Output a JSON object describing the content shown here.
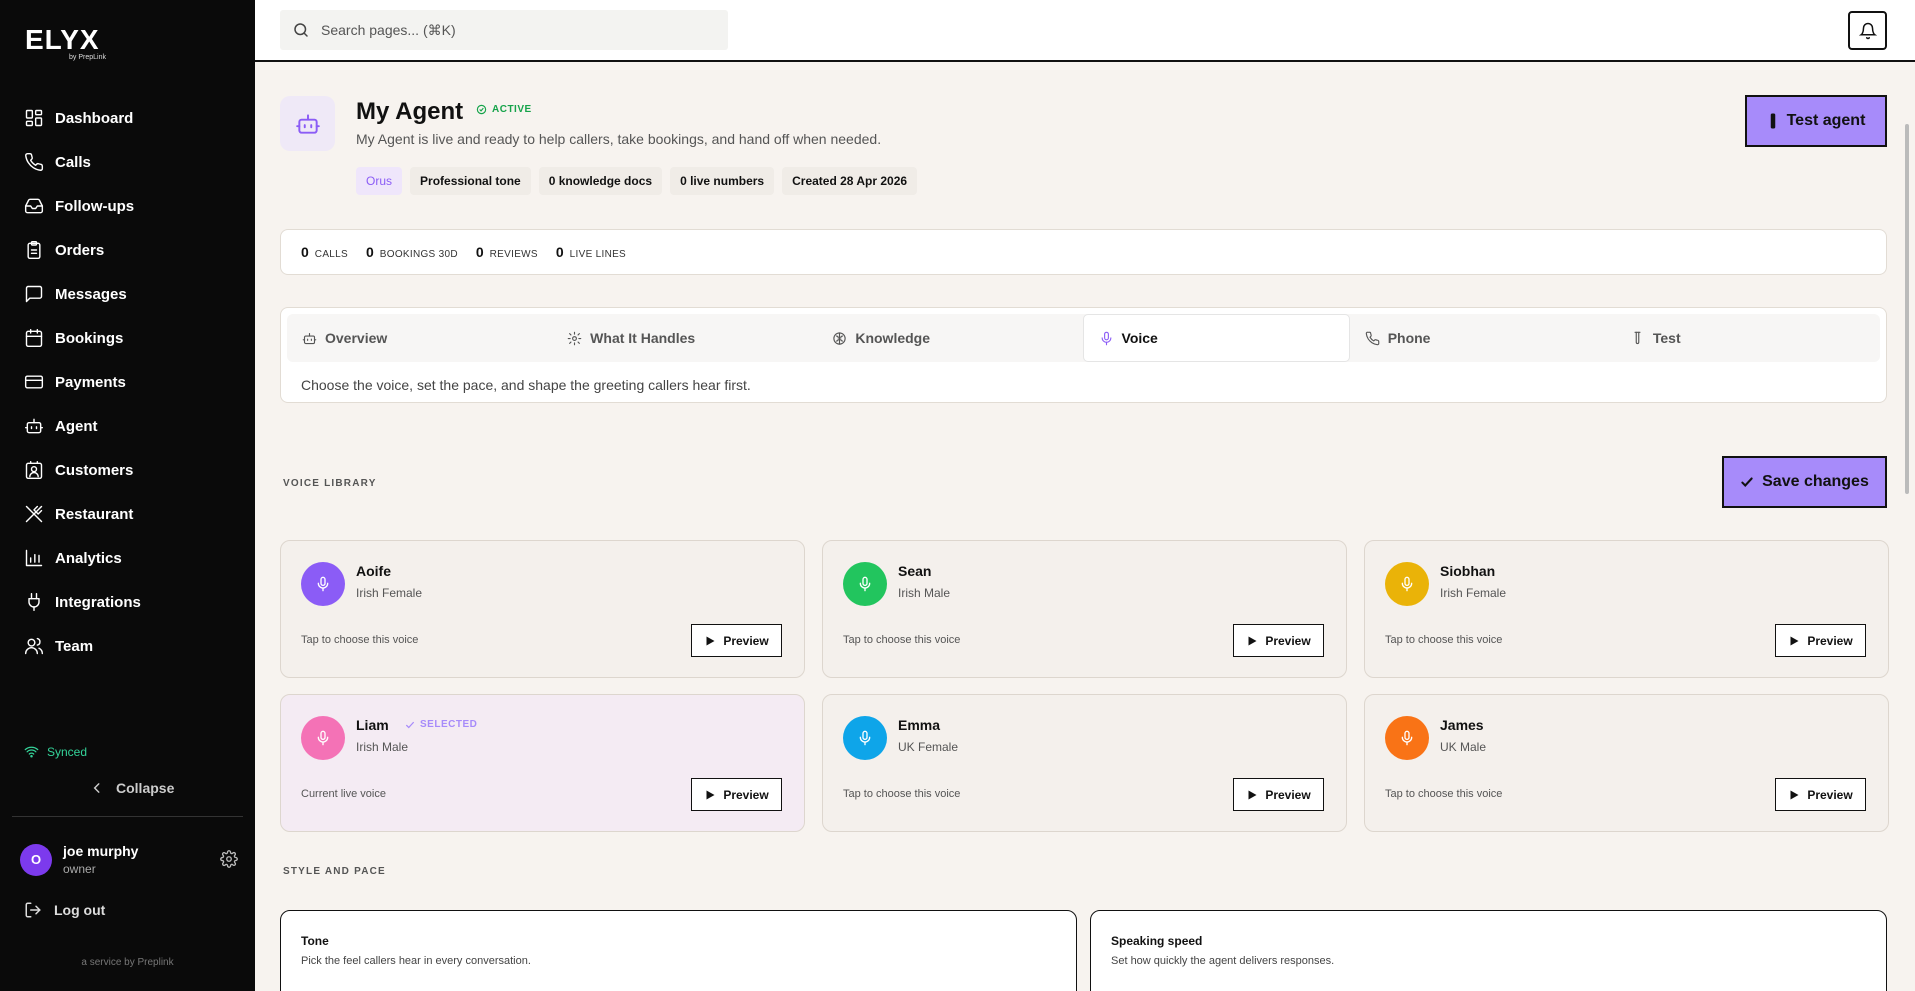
{
  "brand": {
    "logo": "ELYX",
    "logo_sub": "by PrepLink",
    "service": "a service by Preplink"
  },
  "sidebar": {
    "items": [
      {
        "label": "Dashboard",
        "icon": "dashboard-icon"
      },
      {
        "label": "Calls",
        "icon": "phone-icon"
      },
      {
        "label": "Follow-ups",
        "icon": "inbox-icon"
      },
      {
        "label": "Orders",
        "icon": "clipboard-icon"
      },
      {
        "label": "Messages",
        "icon": "message-icon"
      },
      {
        "label": "Bookings",
        "icon": "calendar-icon"
      },
      {
        "label": "Payments",
        "icon": "credit-card-icon"
      },
      {
        "label": "Agent",
        "icon": "robot-icon"
      },
      {
        "label": "Customers",
        "icon": "contact-icon"
      },
      {
        "label": "Restaurant",
        "icon": "utensils-icon"
      },
      {
        "label": "Analytics",
        "icon": "bar-chart-icon"
      },
      {
        "label": "Integrations",
        "icon": "plug-icon"
      },
      {
        "label": "Team",
        "icon": "users-icon"
      }
    ],
    "synced": "Synced",
    "collapse": "Collapse",
    "user": {
      "initial": "O",
      "name": "joe murphy",
      "role": "owner"
    },
    "logout": "Log out"
  },
  "topbar": {
    "search_placeholder": "Search pages... (⌘K)"
  },
  "agent": {
    "title": "My Agent",
    "status": "ACTIVE",
    "description": "My Agent is live and ready to help callers, take bookings, and hand off when needed.",
    "chips": [
      "Orus",
      "Professional tone",
      "0 knowledge docs",
      "0 live numbers",
      "Created 28 Apr 2026"
    ],
    "test_button": "Test agent"
  },
  "stats": [
    {
      "value": "0",
      "label": "CALLS"
    },
    {
      "value": "0",
      "label": "BOOKINGS 30D"
    },
    {
      "value": "0",
      "label": "REVIEWS"
    },
    {
      "value": "0",
      "label": "LIVE LINES"
    }
  ],
  "tabs": [
    {
      "label": "Overview",
      "icon": "robot-icon",
      "active": false
    },
    {
      "label": "What It Handles",
      "icon": "gear-icon",
      "active": false
    },
    {
      "label": "Knowledge",
      "icon": "brain-icon",
      "active": false
    },
    {
      "label": "Voice",
      "icon": "mic-icon",
      "active": true
    },
    {
      "label": "Phone",
      "icon": "phone-icon",
      "active": false
    },
    {
      "label": "Test",
      "icon": "test-tube-icon",
      "active": false
    }
  ],
  "tab_description": "Choose the voice, set the pace, and shape the greeting callers hear first.",
  "voice_library": {
    "label": "VOICE LIBRARY",
    "save_button": "Save changes",
    "selected_badge": "SELECTED",
    "preview_label": "Preview",
    "voices": [
      {
        "name": "Aoife",
        "accent": "Irish Female",
        "hint": "Tap to choose this voice",
        "color": "#8b5cf6",
        "selected": false
      },
      {
        "name": "Sean",
        "accent": "Irish Male",
        "hint": "Tap to choose this voice",
        "color": "#22c55e",
        "selected": false
      },
      {
        "name": "Siobhan",
        "accent": "Irish Female",
        "hint": "Tap to choose this voice",
        "color": "#eab308",
        "selected": false
      },
      {
        "name": "Liam",
        "accent": "Irish Male",
        "hint": "Current live voice",
        "color": "#f472b6",
        "selected": true
      },
      {
        "name": "Emma",
        "accent": "UK Female",
        "hint": "Tap to choose this voice",
        "color": "#0ea5e9",
        "selected": false
      },
      {
        "name": "James",
        "accent": "UK Male",
        "hint": "Tap to choose this voice",
        "color": "#f97316",
        "selected": false
      }
    ]
  },
  "style_pace": {
    "label": "STYLE AND PACE",
    "tone": {
      "title": "Tone",
      "subtitle": "Pick the feel callers hear in every conversation."
    },
    "speed": {
      "title": "Speaking speed",
      "subtitle": "Set how quickly the agent delivers responses."
    }
  }
}
